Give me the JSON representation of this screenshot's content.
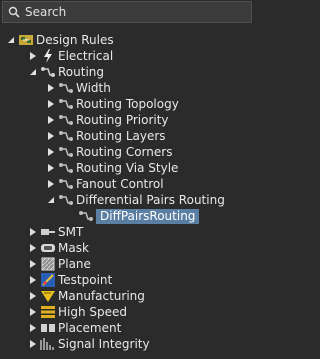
{
  "search": {
    "placeholder": "Search"
  },
  "tree": {
    "root": "Design Rules",
    "electrical": "Electrical",
    "routing": "Routing",
    "routing_children": [
      "Width",
      "Routing Topology",
      "Routing Priority",
      "Routing Layers",
      "Routing Corners",
      "Routing Via Style",
      "Fanout Control",
      "Differential Pairs Routing"
    ],
    "diffpairs_child": "DiffPairsRouting",
    "others": [
      "SMT",
      "Mask",
      "Plane",
      "Testpoint",
      "Manufacturing",
      "High Speed",
      "Placement",
      "Signal Integrity"
    ]
  },
  "colors": {
    "background": "#2b2b2b",
    "selection": "#5b7fa3",
    "text": "#e8e8e8"
  }
}
